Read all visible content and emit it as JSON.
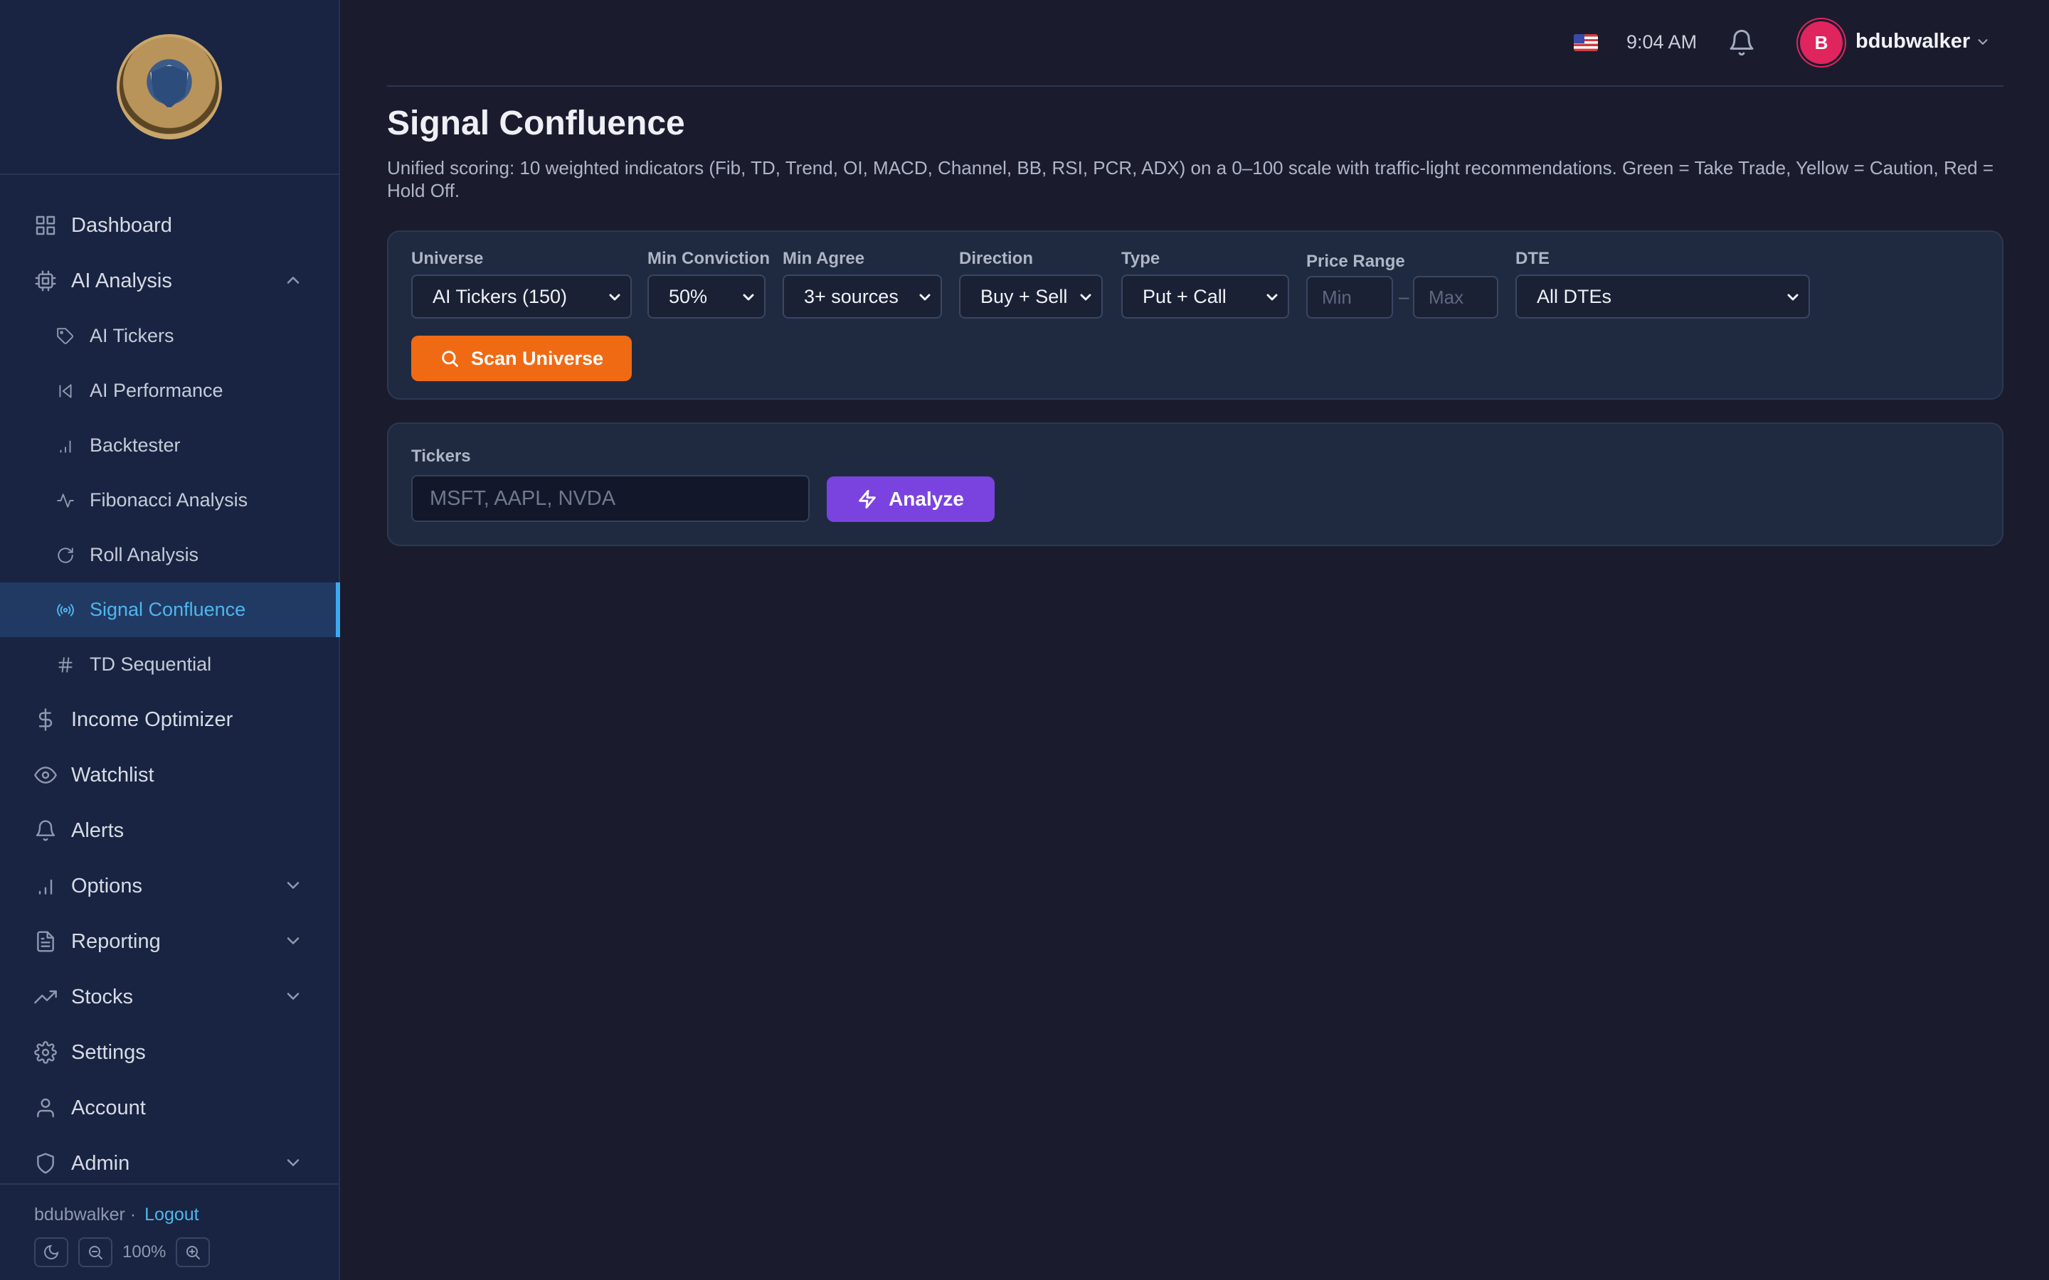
{
  "sidebar": {
    "logo_name": "options-analytics-logo",
    "items": [
      {
        "label": "Dashboard",
        "icon": "grid-icon"
      },
      {
        "label": "AI Analysis",
        "icon": "cpu-icon",
        "expanded": true
      },
      {
        "label": "Income Optimizer",
        "icon": "dollar-icon"
      },
      {
        "label": "Watchlist",
        "icon": "eye-icon"
      },
      {
        "label": "Alerts",
        "icon": "bell-icon"
      },
      {
        "label": "Options",
        "icon": "bar-chart-icon",
        "expanded": false
      },
      {
        "label": "Reporting",
        "icon": "file-text-icon",
        "expanded": false
      },
      {
        "label": "Stocks",
        "icon": "trending-up-icon",
        "expanded": false
      },
      {
        "label": "Settings",
        "icon": "gear-icon"
      },
      {
        "label": "Account",
        "icon": "user-icon"
      },
      {
        "label": "Admin",
        "icon": "shield-icon",
        "expanded": false
      }
    ],
    "sub_items": [
      {
        "label": "AI Tickers",
        "icon": "tag-icon"
      },
      {
        "label": "AI Performance",
        "icon": "skip-back-icon"
      },
      {
        "label": "Backtester",
        "icon": "bar-chart-icon"
      },
      {
        "label": "Fibonacci Analysis",
        "icon": "activity-icon"
      },
      {
        "label": "Roll Analysis",
        "icon": "rotate-icon"
      },
      {
        "label": "Signal Confluence",
        "icon": "radio-icon",
        "active": true
      },
      {
        "label": "TD Sequential",
        "icon": "hash-icon"
      }
    ],
    "footer": {
      "username": "bdubwalker ·",
      "logout": "Logout",
      "zoom": "100%"
    }
  },
  "topbar": {
    "time": "9:04 AM",
    "avatar_initial": "B",
    "username": "bdubwalker"
  },
  "page": {
    "title": "Signal Confluence",
    "description": "Unified scoring: 10 weighted indicators (Fib, TD, Trend, OI, MACD, Channel, BB, RSI, PCR, ADX) on a 0–100 scale with traffic-light recommendations. Green = Take Trade, Yellow = Caution, Red = Hold Off."
  },
  "filters": {
    "universe": {
      "label": "Universe",
      "value": "AI Tickers (150)"
    },
    "min_conviction": {
      "label": "Min Conviction",
      "value": "50%"
    },
    "min_agree": {
      "label": "Min Agree",
      "value": "3+ sources"
    },
    "direction": {
      "label": "Direction",
      "value": "Buy + Sell"
    },
    "type": {
      "label": "Type",
      "value": "Put + Call"
    },
    "price_range": {
      "label": "Price Range",
      "min_placeholder": "Min",
      "max_placeholder": "Max",
      "separator": "–"
    },
    "dte": {
      "label": "DTE",
      "value": "All DTEs"
    },
    "scan_button": "Scan Universe"
  },
  "tickers": {
    "label": "Tickers",
    "placeholder": "MSFT, AAPL, NVDA",
    "analyze_button": "Analyze"
  },
  "colors": {
    "accent_blue": "#4fb6ee",
    "scan_orange": "#f06a14",
    "analyze_purple": "#7a43e0",
    "avatar_pink": "#e0245e"
  }
}
